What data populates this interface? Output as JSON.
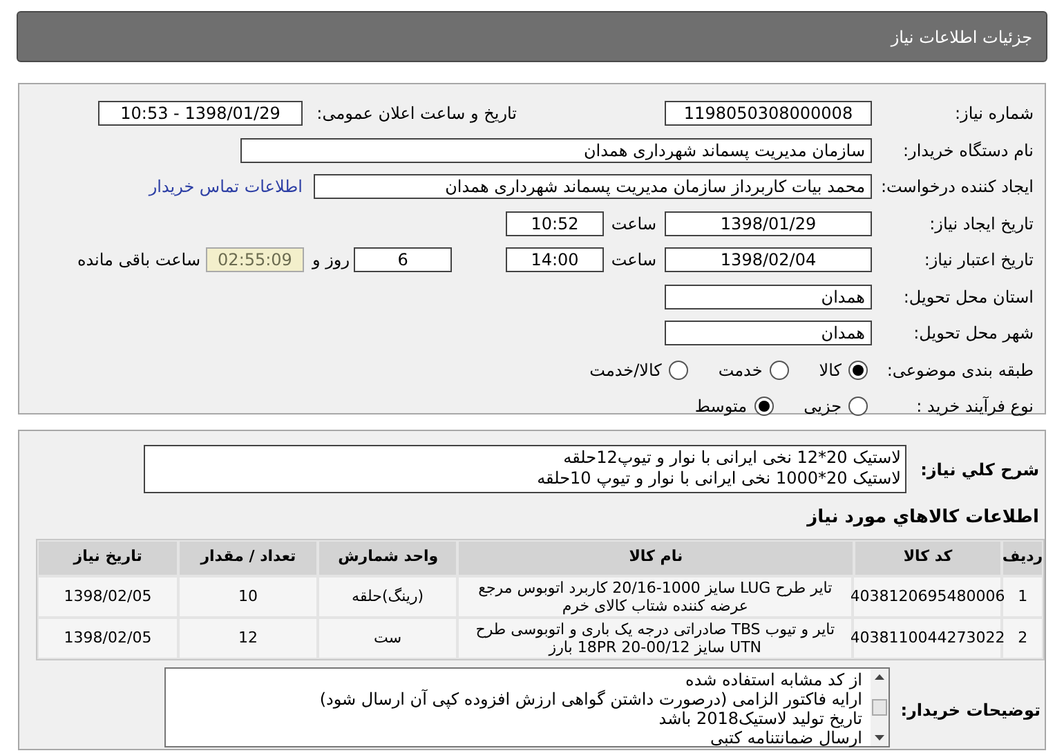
{
  "page_title": "جزئیات اطلاعات نیاز",
  "form": {
    "need_number": {
      "label": "شماره نیاز:",
      "value": "1198050308000008"
    },
    "announce": {
      "label": "تاریخ و ساعت اعلان عمومی:",
      "value": "1398/01/29 - 10:53"
    },
    "buyer_org": {
      "label": "نام دستگاه خریدار:",
      "value": "سازمان مدیریت پسماند شهرداری همدان"
    },
    "requester": {
      "label": "ایجاد کننده درخواست:",
      "value": "محمد بیات کاربرداز سازمان مدیریت پسماند شهرداری همدان",
      "link": "اطلاعات تماس خریدار"
    },
    "created": {
      "label": "تاریخ ایجاد نیاز:",
      "date": "1398/01/29",
      "time_label": "ساعت",
      "time": "10:52"
    },
    "valid_until": {
      "label": "تاریخ اعتبار نیاز:",
      "date": "1398/02/04",
      "time_label": "ساعت",
      "time": "14:00",
      "days": "6",
      "days_label": "روز و",
      "remaining": "02:55:09",
      "remaining_label": "ساعت باقی مانده"
    },
    "province": {
      "label": "استان محل تحویل:",
      "value": "همدان"
    },
    "city": {
      "label": "شهر محل تحویل:",
      "value": "همدان"
    },
    "category": {
      "label": "طبقه بندی موضوعی:",
      "options": [
        {
          "label": "کالا",
          "selected": true
        },
        {
          "label": "خدمت",
          "selected": false
        },
        {
          "label": "کالا/خدمت",
          "selected": false
        }
      ]
    },
    "process": {
      "label": "نوع فرآیند خرید :",
      "options": [
        {
          "label": "جزیی",
          "selected": false
        },
        {
          "label": "متوسط",
          "selected": true
        }
      ]
    }
  },
  "description": {
    "label": "شرح کلي نياز:",
    "lines": [
      "لاستیک 20*12 نخی ایرانی با نوار و تیوپ12حلقه",
      "لاستیک 20*1000 نخی ایرانی با نوار و تیوپ 10حلقه"
    ]
  },
  "items_title": "اطلاعات كالاهاي مورد نياز",
  "table": {
    "columns": [
      "ردیف",
      "کد کالا",
      "نام کالا",
      "واحد شمارش",
      "تعداد / مقدار",
      "تاریخ نیاز"
    ],
    "rows": [
      [
        "1",
        "4038120695480006",
        "تایر طرح LUG سایز 1000-20/16 کاربرد اتوبوس مرجع عرضه کننده شتاب کالای خرم",
        "(رینگ)حلقه",
        "10",
        "1398/02/05"
      ],
      [
        "2",
        "4038110044273022",
        "تایر و تیوب TBS صادراتی درجه یک باری و اتوبوسی طرح UTN سایز 00/12-20 18PR بارز",
        "ست",
        "12",
        "1398/02/05"
      ]
    ]
  },
  "buyer_notes": {
    "label": "توضیحات خریدار:",
    "lines": [
      "از کد مشابه استفاده شده",
      "ارایه فاکتور الزامی (درصورت داشتن گواهی ارزش افزوده کپی آن ارسال شود)",
      "تاریخ تولید لاستیک2018 باشد",
      "ارسال ضمانتنامه کتبی"
    ]
  }
}
